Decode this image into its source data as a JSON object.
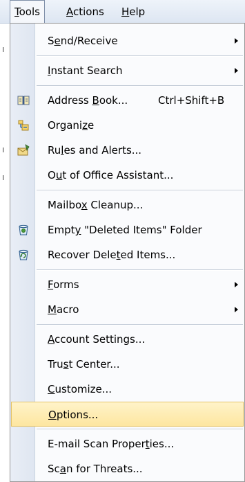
{
  "menubar": {
    "items": [
      {
        "pre": "",
        "acc": "T",
        "post": "ools"
      },
      {
        "pre": "",
        "acc": "A",
        "post": "ctions"
      },
      {
        "pre": "",
        "acc": "H",
        "post": "elp"
      }
    ]
  },
  "menu": {
    "send_receive": {
      "pre": "S",
      "acc": "e",
      "post": "nd/Receive"
    },
    "instant_search": {
      "pre": "",
      "acc": "I",
      "post": "nstant Search"
    },
    "address_book": {
      "pre": "Address ",
      "acc": "B",
      "post": "ook...",
      "shortcut": "Ctrl+Shift+B"
    },
    "organize": {
      "pre": "Organi",
      "acc": "z",
      "post": "e"
    },
    "rules_alerts": {
      "pre": "Ru",
      "acc": "l",
      "post": "es and Alerts..."
    },
    "out_of_office": {
      "pre": "O",
      "acc": "u",
      "post": "t of Office Assistant..."
    },
    "mailbox_cleanup": {
      "pre": "Mailbo",
      "acc": "x",
      "post": " Cleanup..."
    },
    "empty_deleted": {
      "pre": "Empt",
      "acc": "y",
      "post": " \"Deleted Items\" Folder"
    },
    "recover_deleted": {
      "pre": "Recover Dele",
      "acc": "t",
      "post": "ed Items..."
    },
    "forms": {
      "pre": "",
      "acc": "F",
      "post": "orms"
    },
    "macro": {
      "pre": "",
      "acc": "M",
      "post": "acro"
    },
    "account_settings": {
      "pre": "",
      "acc": "A",
      "post": "ccount Settings..."
    },
    "trust_center": {
      "pre": "Tru",
      "acc": "s",
      "post": "t Center..."
    },
    "customize": {
      "pre": "",
      "acc": "C",
      "post": "ustomize..."
    },
    "options": {
      "pre": "",
      "acc": "O",
      "post": "ptions..."
    },
    "email_scan": {
      "pre": "E-mail Scan Proper",
      "acc": "t",
      "post": "ies..."
    },
    "scan_threats": {
      "pre": "Sc",
      "acc": "a",
      "post": "n for Threats..."
    }
  }
}
